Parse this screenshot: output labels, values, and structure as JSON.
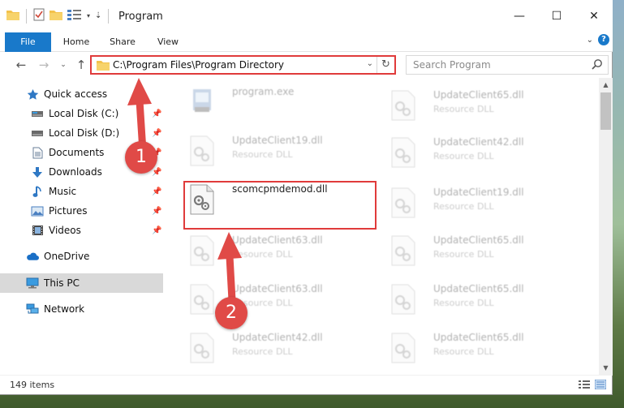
{
  "window": {
    "title": "Program",
    "controls": {
      "minimize": "—",
      "maximize": "☐",
      "close": "✕"
    }
  },
  "ribbon": {
    "tabs": [
      {
        "label": "File"
      },
      {
        "label": "Home"
      },
      {
        "label": "Share"
      },
      {
        "label": "View"
      }
    ],
    "help": "?"
  },
  "navigation": {
    "address": "C:\\Program Files\\Program Directory",
    "search_placeholder": "Search Program"
  },
  "sidebar": {
    "quick_access": "Quick access",
    "items": [
      {
        "label": "Local Disk (C:)",
        "icon": "drive-icon",
        "pinned": true
      },
      {
        "label": "Local Disk (D:)",
        "icon": "drive-icon",
        "pinned": true
      },
      {
        "label": "Documents",
        "icon": "documents-icon",
        "pinned": true
      },
      {
        "label": "Downloads",
        "icon": "downloads-icon",
        "pinned": true
      },
      {
        "label": "Music",
        "icon": "music-icon",
        "pinned": true
      },
      {
        "label": "Pictures",
        "icon": "pictures-icon",
        "pinned": true
      },
      {
        "label": "Videos",
        "icon": "videos-icon",
        "pinned": true
      }
    ],
    "onedrive": "OneDrive",
    "this_pc": "This PC",
    "network": "Network"
  },
  "files": {
    "left": [
      {
        "name": "program.exe",
        "type": ""
      },
      {
        "name": "UpdateClient19.dll",
        "type": "Resource DLL"
      },
      {
        "name": "scomcpmdemod.dll",
        "type": ""
      },
      {
        "name": "UpdateClient63.dll",
        "type": "Resource DLL"
      },
      {
        "name": "UpdateClient63.dll",
        "type": "Resource DLL"
      },
      {
        "name": "UpdateClient42.dll",
        "type": "Resource DLL"
      }
    ],
    "right": [
      {
        "name": "UpdateClient65.dll",
        "type": "Resource DLL"
      },
      {
        "name": "UpdateClient42.dll",
        "type": "Resource DLL"
      },
      {
        "name": "UpdateClient19.dll",
        "type": "Resource DLL"
      },
      {
        "name": "UpdateClient65.dll",
        "type": "Resource DLL"
      },
      {
        "name": "UpdateClient65.dll",
        "type": "Resource DLL"
      },
      {
        "name": "UpdateClient65.dll",
        "type": "Resource DLL"
      }
    ]
  },
  "status": {
    "item_count": "149 items"
  },
  "annotations": {
    "step1": "1",
    "step2": "2",
    "color": "#e03b3b"
  },
  "colors": {
    "accent": "#1979ca",
    "highlight": "#e03b3b"
  }
}
